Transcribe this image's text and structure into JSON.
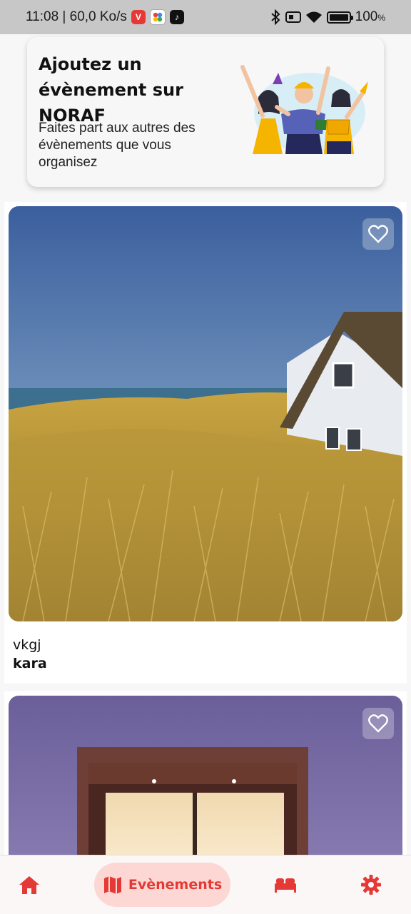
{
  "status_bar": {
    "time_speed": "11:08 | 60,0 Ko/s",
    "apps": [
      "vivaldi-icon",
      "photos-icon",
      "tiktok-icon"
    ],
    "battery": "100",
    "battery_unit": "%"
  },
  "banner": {
    "title": "Ajoutez un évènement sur NORAF",
    "subtitle": "Faites part aux autres des évènements que vous organisez"
  },
  "events": [
    {
      "name": "vkgj",
      "place": "kara",
      "favorite": false
    },
    {
      "name": "",
      "place": "",
      "favorite": false
    }
  ],
  "bottom_nav": {
    "items": [
      {
        "id": "home",
        "icon": "home-icon"
      },
      {
        "id": "events",
        "icon": "map-icon",
        "label": "Evènements",
        "active": true
      },
      {
        "id": "stays",
        "icon": "bed-icon"
      },
      {
        "id": "settings",
        "icon": "gear-icon"
      }
    ],
    "accent": "#e53935",
    "active_bg": "#fcd7d3"
  }
}
